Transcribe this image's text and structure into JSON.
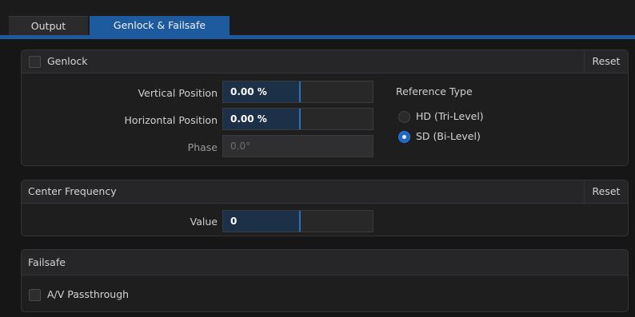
{
  "tabs": [
    {
      "label": "Output",
      "active": false
    },
    {
      "label": "Genlock & Failsafe",
      "active": true
    }
  ],
  "genlock": {
    "title": "Genlock",
    "enabled": false,
    "reset_label": "Reset",
    "fields": [
      {
        "label": "Vertical Position",
        "value": "0.00 %",
        "disabled": false
      },
      {
        "label": "Horizontal Position",
        "value": "0.00 %",
        "disabled": false
      },
      {
        "label": "Phase",
        "value": "0.0°",
        "disabled": true
      }
    ],
    "reference_type": {
      "title": "Reference Type",
      "options": [
        {
          "label": "HD (Tri-Level)",
          "selected": false
        },
        {
          "label": "SD (Bi-Level)",
          "selected": true
        }
      ]
    }
  },
  "center_frequency": {
    "title": "Center Frequency",
    "reset_label": "Reset",
    "field": {
      "label": "Value",
      "value": "0"
    }
  },
  "failsafe": {
    "title": "Failsafe",
    "passthrough_label": "A/V Passthrough",
    "passthrough_enabled": false
  },
  "colors": {
    "accent": "#1d5a9e",
    "radio_selected": "#1e66c2",
    "slider_fill": "#1c3148"
  }
}
